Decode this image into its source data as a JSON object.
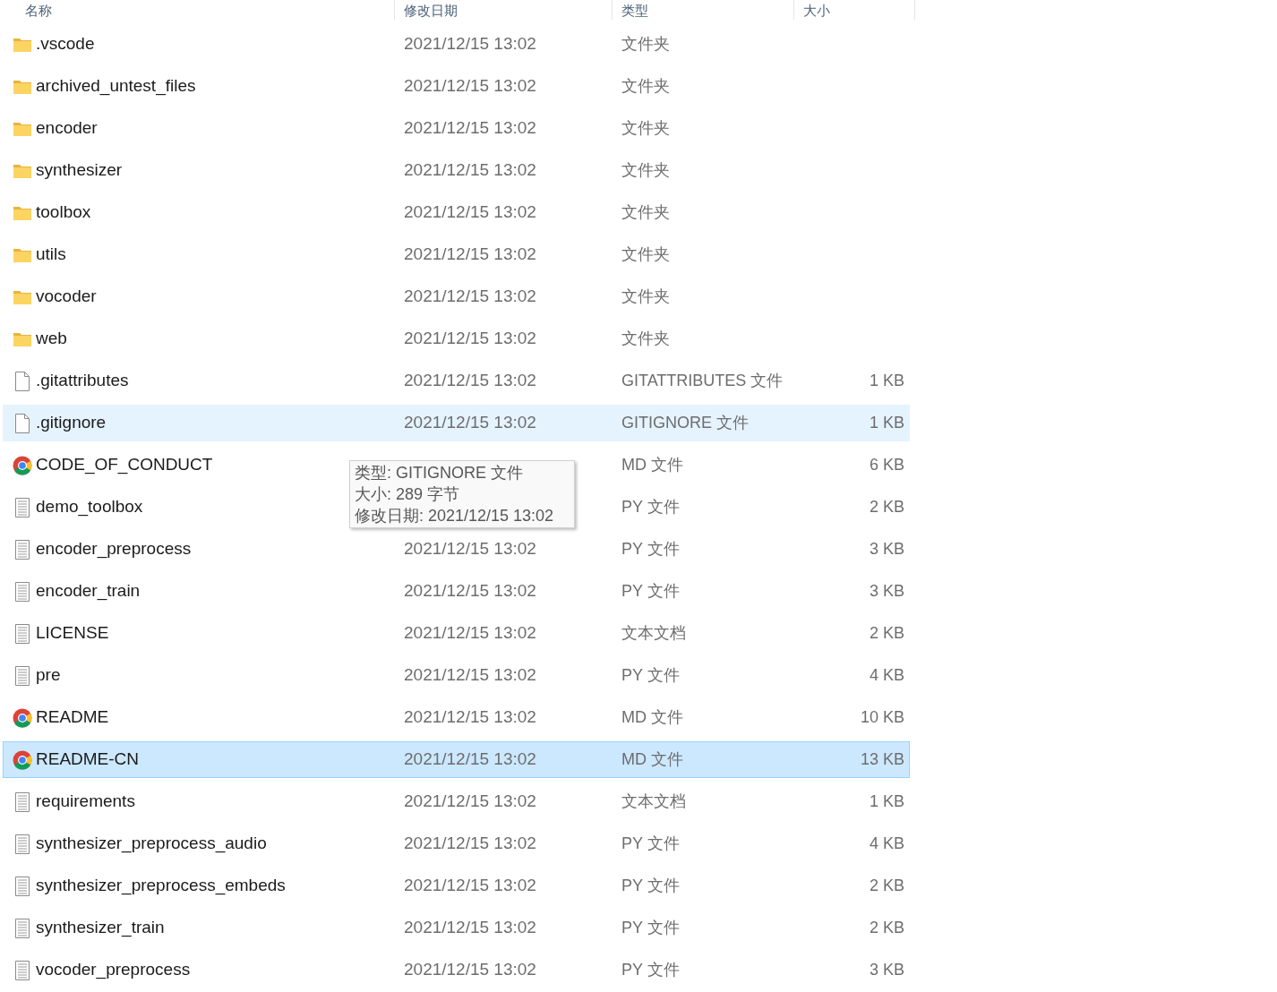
{
  "columns": [
    "名称",
    "修改日期",
    "类型",
    "大小"
  ],
  "files": [
    {
      "name": ".vscode",
      "date": "2021/12/15 13:02",
      "type": "文件夹",
      "kind": "folder",
      "selected": false,
      "hovered": false
    },
    {
      "name": "archived_untest_files",
      "date": "2021/12/15 13:02",
      "type": "文件夹",
      "kind": "folder",
      "selected": false,
      "hovered": false
    },
    {
      "name": "encoder",
      "date": "2021/12/15 13:02",
      "type": "文件夹",
      "kind": "folder",
      "selected": false,
      "hovered": false
    },
    {
      "name": "synthesizer",
      "date": "2021/12/15 13:02",
      "type": "文件夹",
      "kind": "folder",
      "selected": false,
      "hovered": false
    },
    {
      "name": "toolbox",
      "date": "2021/12/15 13:02",
      "type": "文件夹",
      "kind": "folder",
      "selected": false,
      "hovered": false
    },
    {
      "name": "utils",
      "date": "2021/12/15 13:02",
      "type": "文件夹",
      "kind": "folder",
      "selected": false,
      "hovered": false
    },
    {
      "name": "vocoder",
      "date": "2021/12/15 13:02",
      "type": "文件夹",
      "kind": "folder",
      "selected": false,
      "hovered": false
    },
    {
      "name": "web",
      "date": "2021/12/15 13:02",
      "type": "文件夹",
      "kind": "folder",
      "selected": false,
      "hovered": false
    },
    {
      "name": ".gitattributes",
      "date": "2021/12/15 13:02",
      "type": "GITATTRIBUTES 文件",
      "size": "1 KB",
      "kind": "blank",
      "selected": false,
      "hovered": false
    },
    {
      "name": ".gitignore",
      "date": "2021/12/15 13:02",
      "type": "GITIGNORE 文件",
      "size": "1 KB",
      "kind": "blank",
      "selected": false,
      "hovered": true
    },
    {
      "name": "CODE_OF_CONDUCT",
      "type": "MD 文件",
      "size": "6 KB",
      "kind": "browser",
      "selected": false,
      "hovered": false
    },
    {
      "name": "demo_toolbox",
      "type": "PY 文件",
      "size": "2 KB",
      "kind": "text",
      "selected": false,
      "hovered": false
    },
    {
      "name": "encoder_preprocess",
      "date": "2021/12/15 13:02",
      "type": "PY 文件",
      "size": "3 KB",
      "kind": "text",
      "selected": false,
      "hovered": false
    },
    {
      "name": "encoder_train",
      "date": "2021/12/15 13:02",
      "type": "PY 文件",
      "size": "3 KB",
      "kind": "text",
      "selected": false,
      "hovered": false
    },
    {
      "name": "LICENSE",
      "date": "2021/12/15 13:02",
      "type": "文本文档",
      "size": "2 KB",
      "kind": "text",
      "selected": false,
      "hovered": false
    },
    {
      "name": "pre",
      "date": "2021/12/15 13:02",
      "type": "PY 文件",
      "size": "4 KB",
      "kind": "text",
      "selected": false,
      "hovered": false
    },
    {
      "name": "README",
      "date": "2021/12/15 13:02",
      "type": "MD 文件",
      "size": "10 KB",
      "kind": "browser",
      "selected": false,
      "hovered": false
    },
    {
      "name": "README-CN",
      "date": "2021/12/15 13:02",
      "type": "MD 文件",
      "size": "13 KB",
      "kind": "browser",
      "selected": true,
      "hovered": false
    },
    {
      "name": "requirements",
      "date": "2021/12/15 13:02",
      "type": "文本文档",
      "size": "1 KB",
      "kind": "text",
      "selected": false,
      "hovered": false
    },
    {
      "name": "synthesizer_preprocess_audio",
      "date": "2021/12/15 13:02",
      "type": "PY 文件",
      "size": "4 KB",
      "kind": "text",
      "selected": false,
      "hovered": false
    },
    {
      "name": "synthesizer_preprocess_embeds",
      "date": "2021/12/15 13:02",
      "type": "PY 文件",
      "size": "2 KB",
      "kind": "text",
      "selected": false,
      "hovered": false
    },
    {
      "name": "synthesizer_train",
      "date": "2021/12/15 13:02",
      "type": "PY 文件",
      "size": "2 KB",
      "kind": "text",
      "selected": false,
      "hovered": false
    },
    {
      "name": "vocoder_preprocess",
      "date": "2021/12/15 13:02",
      "type": "PY 文件",
      "size": "3 KB",
      "kind": "text",
      "selected": false,
      "hovered": false
    }
  ],
  "tooltip": {
    "lines": [
      "类型: GITIGNORE 文件",
      "大小: 289 字节",
      "修改日期: 2021/12/15 13:02"
    ]
  }
}
